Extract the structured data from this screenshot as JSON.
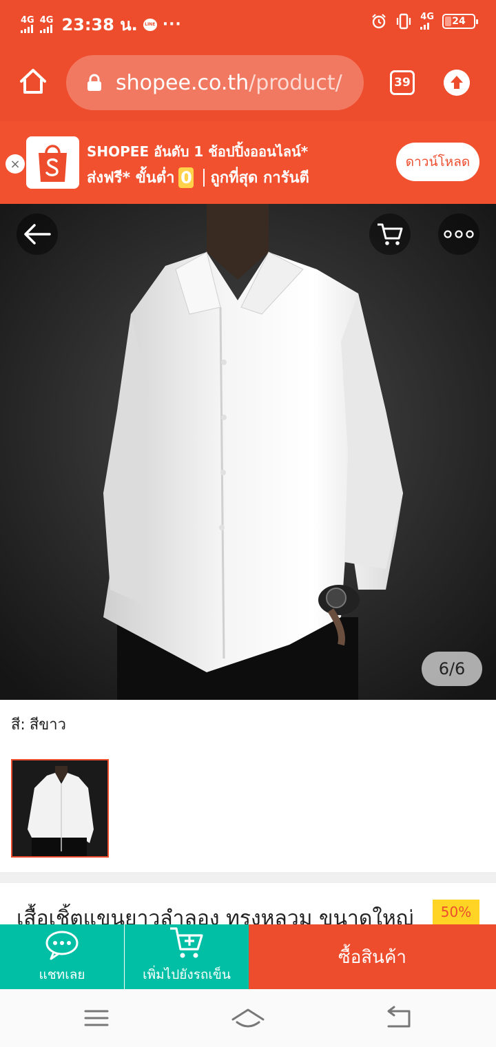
{
  "status_bar": {
    "sim1": "4G",
    "sim2": "4G",
    "time": "23:38 น.",
    "line_label": "LINE",
    "more": "···",
    "network": "4G",
    "battery": "24"
  },
  "browser": {
    "url_host": "shopee.co.th",
    "url_path": "/product/",
    "tab_count": "39"
  },
  "banner": {
    "close": "×",
    "line1": "SHOPEE อันดับ 1 ช้อปปิ้งออนไลน์*",
    "line2_a": "ส่งฟรี* ขั้นต่ำ",
    "zero": "0",
    "line2_b": "ถูกที่สุด การันตี",
    "download": "ดาวน์โหลด"
  },
  "gallery": {
    "counter": "6/6"
  },
  "variation": {
    "label": "สี:",
    "value": "สีขาว"
  },
  "product": {
    "title": "เสื้อเชิ้ตแขนยาวลำลอง ทรงหลวม ขนาดใหญ่",
    "discount": "50%"
  },
  "actions": {
    "chat": "แชทเลย",
    "add_to_cart": "เพิ่มไปยังรถเข็น",
    "buy": "ซื้อสินค้า"
  },
  "colors": {
    "brand": "#ee4d2d",
    "teal": "#00bfa5",
    "badge": "#ffd424"
  }
}
